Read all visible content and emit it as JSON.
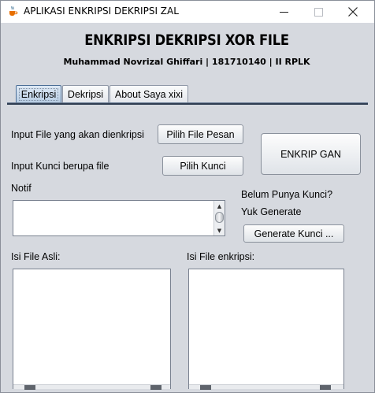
{
  "window": {
    "title": "APLIKASI ENKRIPSI DEKRIPSI ZAL"
  },
  "header": {
    "title": "ENKRIPSI DEKRIPSI XOR FILE",
    "subtitle": "Muhammad Novrizal Ghiffari | 181710140 | II RPLK"
  },
  "tabs": [
    {
      "label": "Enkripsi",
      "selected": true
    },
    {
      "label": "Dekripsi",
      "selected": false
    },
    {
      "label": "About Saya xixi",
      "selected": false
    }
  ],
  "form": {
    "input_file_label": "Input File yang akan dienkripsi",
    "pick_file_button": "Pilih File Pesan",
    "input_key_label": "Input Kunci berupa file",
    "pick_key_button": "Pilih Kunci",
    "encrypt_button": "ENKRIP GAN",
    "notif_label": "Notif",
    "notif_value": "",
    "no_key_label": "Belum Punya Kunci?",
    "generate_prompt": "Yuk Generate",
    "generate_button": "Generate Kunci ...",
    "original_label": "Isi File Asli:",
    "original_value": "",
    "encrypted_label": "Isi File enkripsi:",
    "encrypted_value": ""
  },
  "icons": {
    "app": "java-cup-icon",
    "minimize": "minimize-icon",
    "maximize": "maximize-icon",
    "close": "close-icon"
  }
}
